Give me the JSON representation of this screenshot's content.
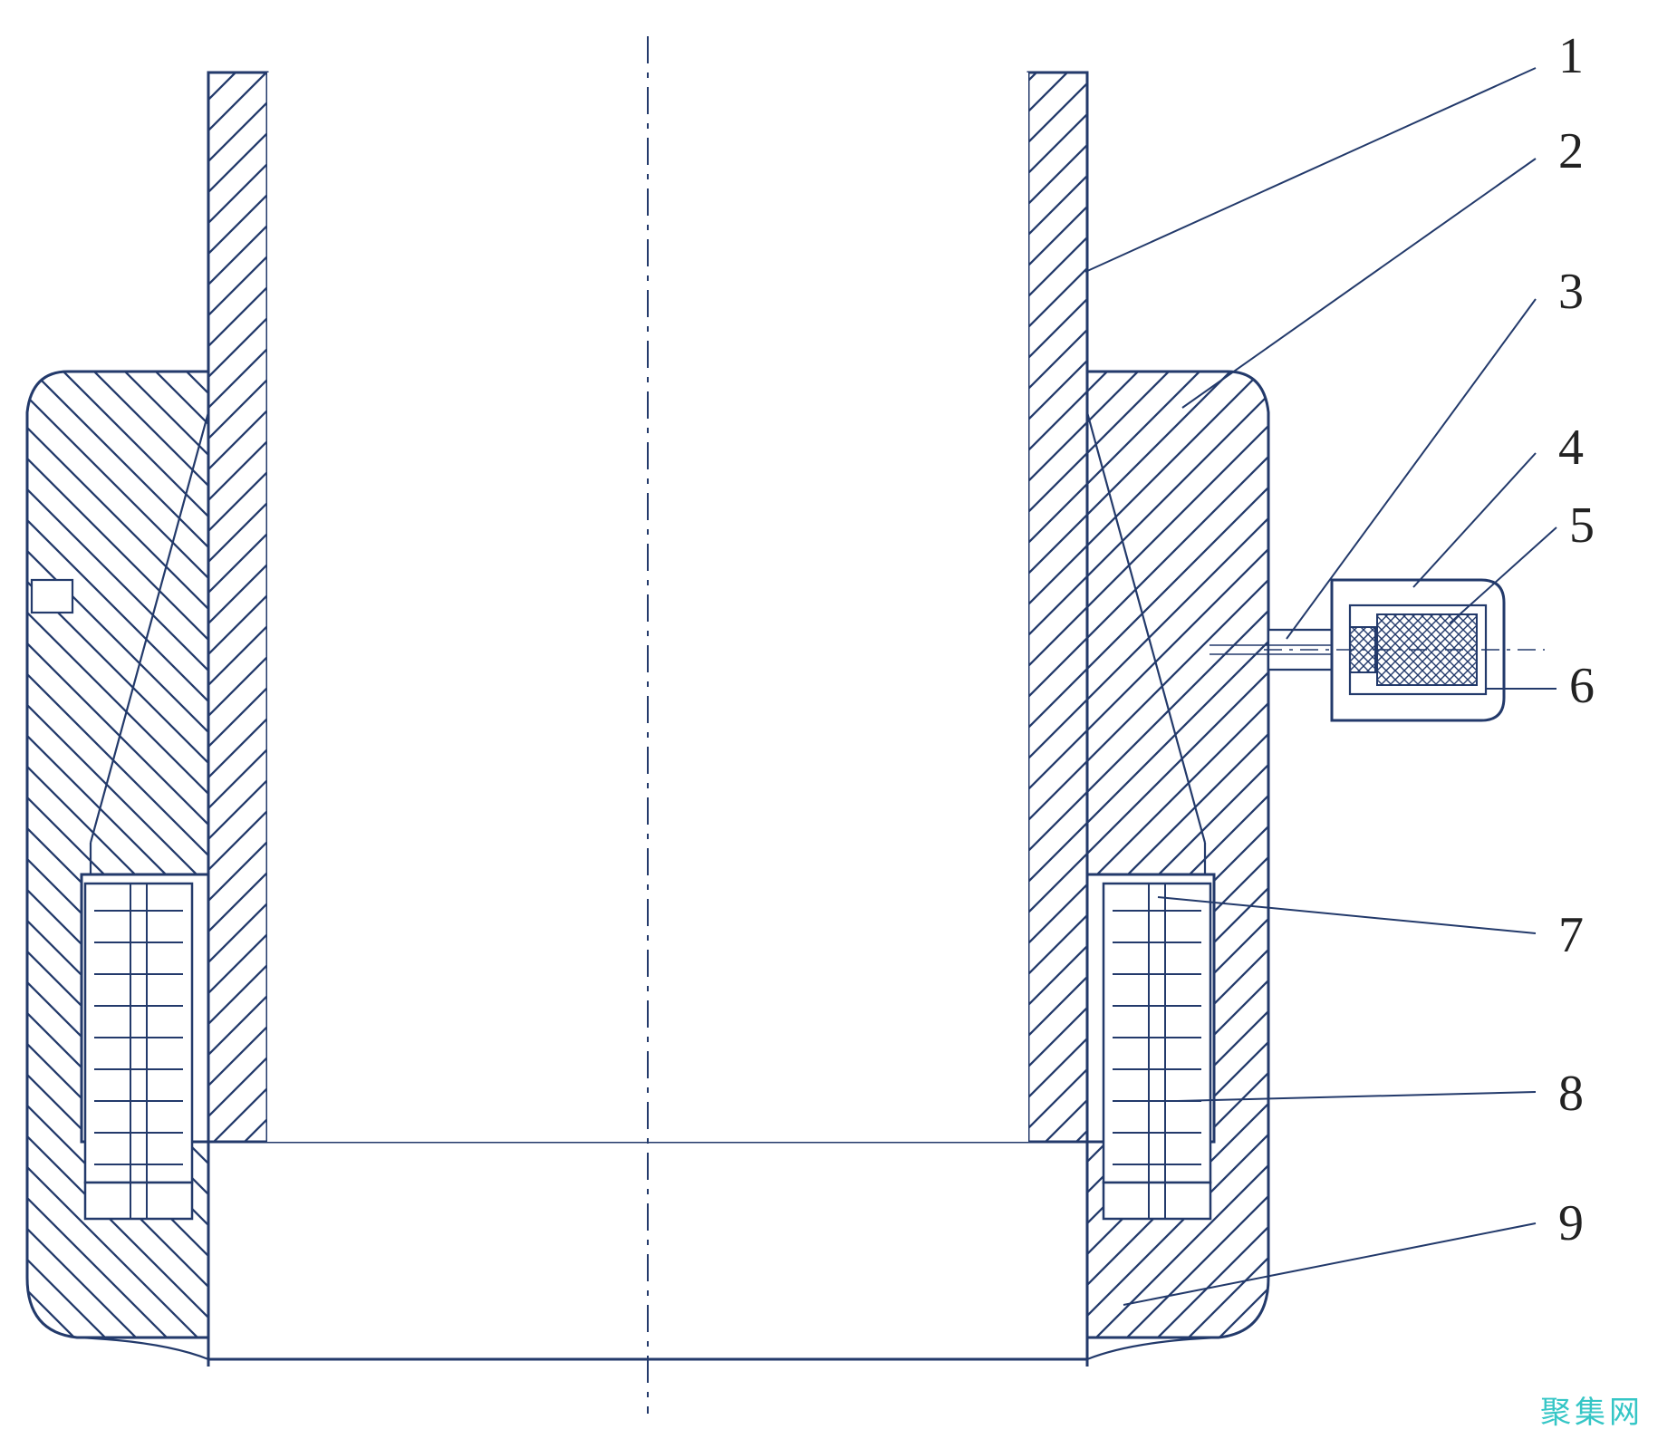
{
  "labels": {
    "l1": "1",
    "l2": "2",
    "l3": "3",
    "l4": "4",
    "l5": "5",
    "l6": "6",
    "l7": "7",
    "l8": "8",
    "l9": "9"
  },
  "watermark": "聚集网"
}
